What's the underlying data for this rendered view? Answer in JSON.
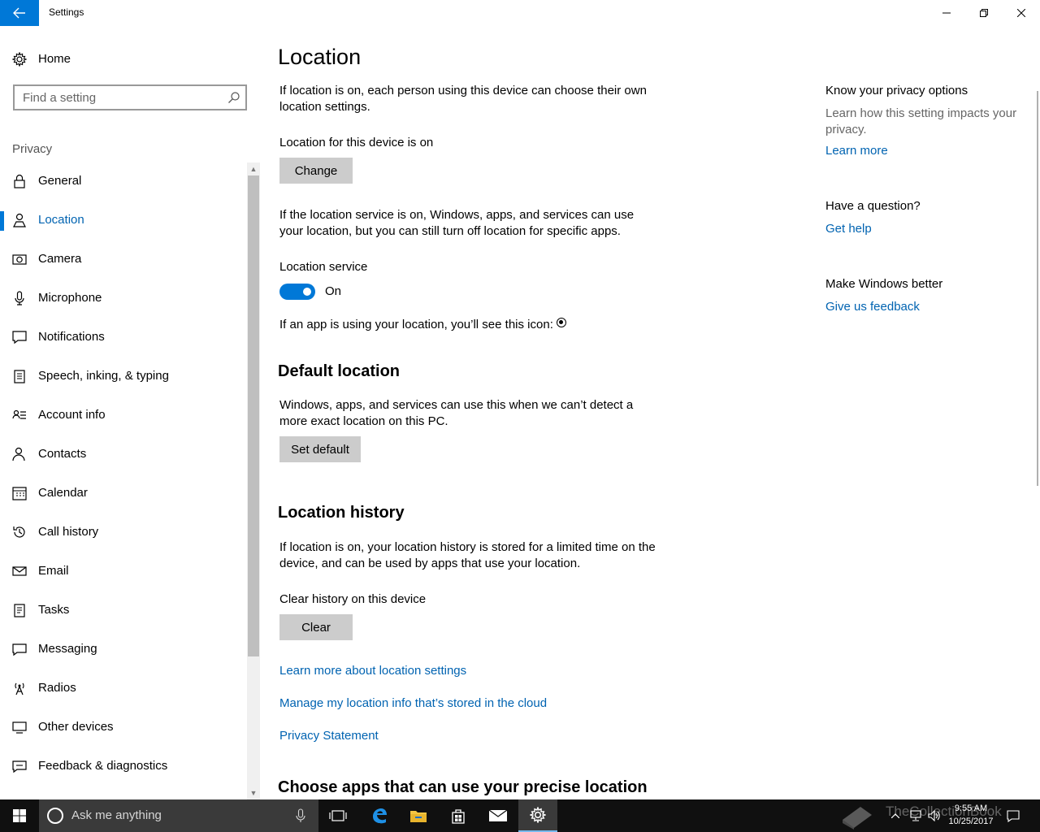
{
  "window": {
    "title": "Settings",
    "back_icon": "arrow-left-icon",
    "controls": [
      "minimize-icon",
      "restore-icon",
      "close-icon"
    ]
  },
  "nav": {
    "home_label": "Home",
    "search_placeholder": "Find a setting",
    "section_label": "Privacy",
    "selected": "Location",
    "items": [
      {
        "label": "General",
        "icon": "lock-icon"
      },
      {
        "label": "Location",
        "icon": "person-pin-icon"
      },
      {
        "label": "Camera",
        "icon": "camera-icon"
      },
      {
        "label": "Microphone",
        "icon": "microphone-icon"
      },
      {
        "label": "Notifications",
        "icon": "notification-icon"
      },
      {
        "label": "Speech, inking, & typing",
        "icon": "clipboard-icon"
      },
      {
        "label": "Account info",
        "icon": "contact-card-icon"
      },
      {
        "label": "Contacts",
        "icon": "people-icon"
      },
      {
        "label": "Calendar",
        "icon": "calendar-icon"
      },
      {
        "label": "Call history",
        "icon": "history-icon"
      },
      {
        "label": "Email",
        "icon": "mail-icon"
      },
      {
        "label": "Tasks",
        "icon": "tasks-icon"
      },
      {
        "label": "Messaging",
        "icon": "message-icon"
      },
      {
        "label": "Radios",
        "icon": "antenna-icon"
      },
      {
        "label": "Other devices",
        "icon": "devices-icon"
      },
      {
        "label": "Feedback & diagnostics",
        "icon": "feedback-icon"
      }
    ]
  },
  "main": {
    "title": "Location",
    "intro": "If location is on, each person using this device can choose their own location settings.",
    "device_status": "Location for this device is on",
    "change_button": "Change",
    "service_desc": "If the location service is on, Windows, apps, and services can use your location, but you can still turn off location for specific apps.",
    "service_label": "Location service",
    "service_state": "On",
    "icon_note": "If an app is using your location, you’ll see this icon:",
    "default_heading": "Default location",
    "default_desc": "Windows, apps, and services can use this when we can’t detect a more exact location on this PC.",
    "set_default_button": "Set default",
    "history_heading": "Location history",
    "history_desc": "If location is on, your location history is stored for a limited time on the device, and can be used by apps that use your location.",
    "clear_label": "Clear history on this device",
    "clear_button": "Clear",
    "link_learn_more": "Learn more about location settings",
    "link_manage_cloud": "Manage my location info that’s stored in the cloud",
    "link_privacy": "Privacy Statement",
    "apps_heading": "Choose apps that can use your precise location"
  },
  "side": {
    "privacy_heading": "Know your privacy options",
    "privacy_text": "Learn how this setting impacts your privacy.",
    "privacy_link": "Learn more",
    "question_heading": "Have a question?",
    "question_link": "Get help",
    "better_heading": "Make Windows better",
    "better_link": "Give us feedback"
  },
  "taskbar": {
    "search_placeholder": "Ask me anything",
    "time": "9:55 AM",
    "date": "10/25/2017",
    "watermark": "TheCollectionBook",
    "accent_color": "#0078d7"
  }
}
